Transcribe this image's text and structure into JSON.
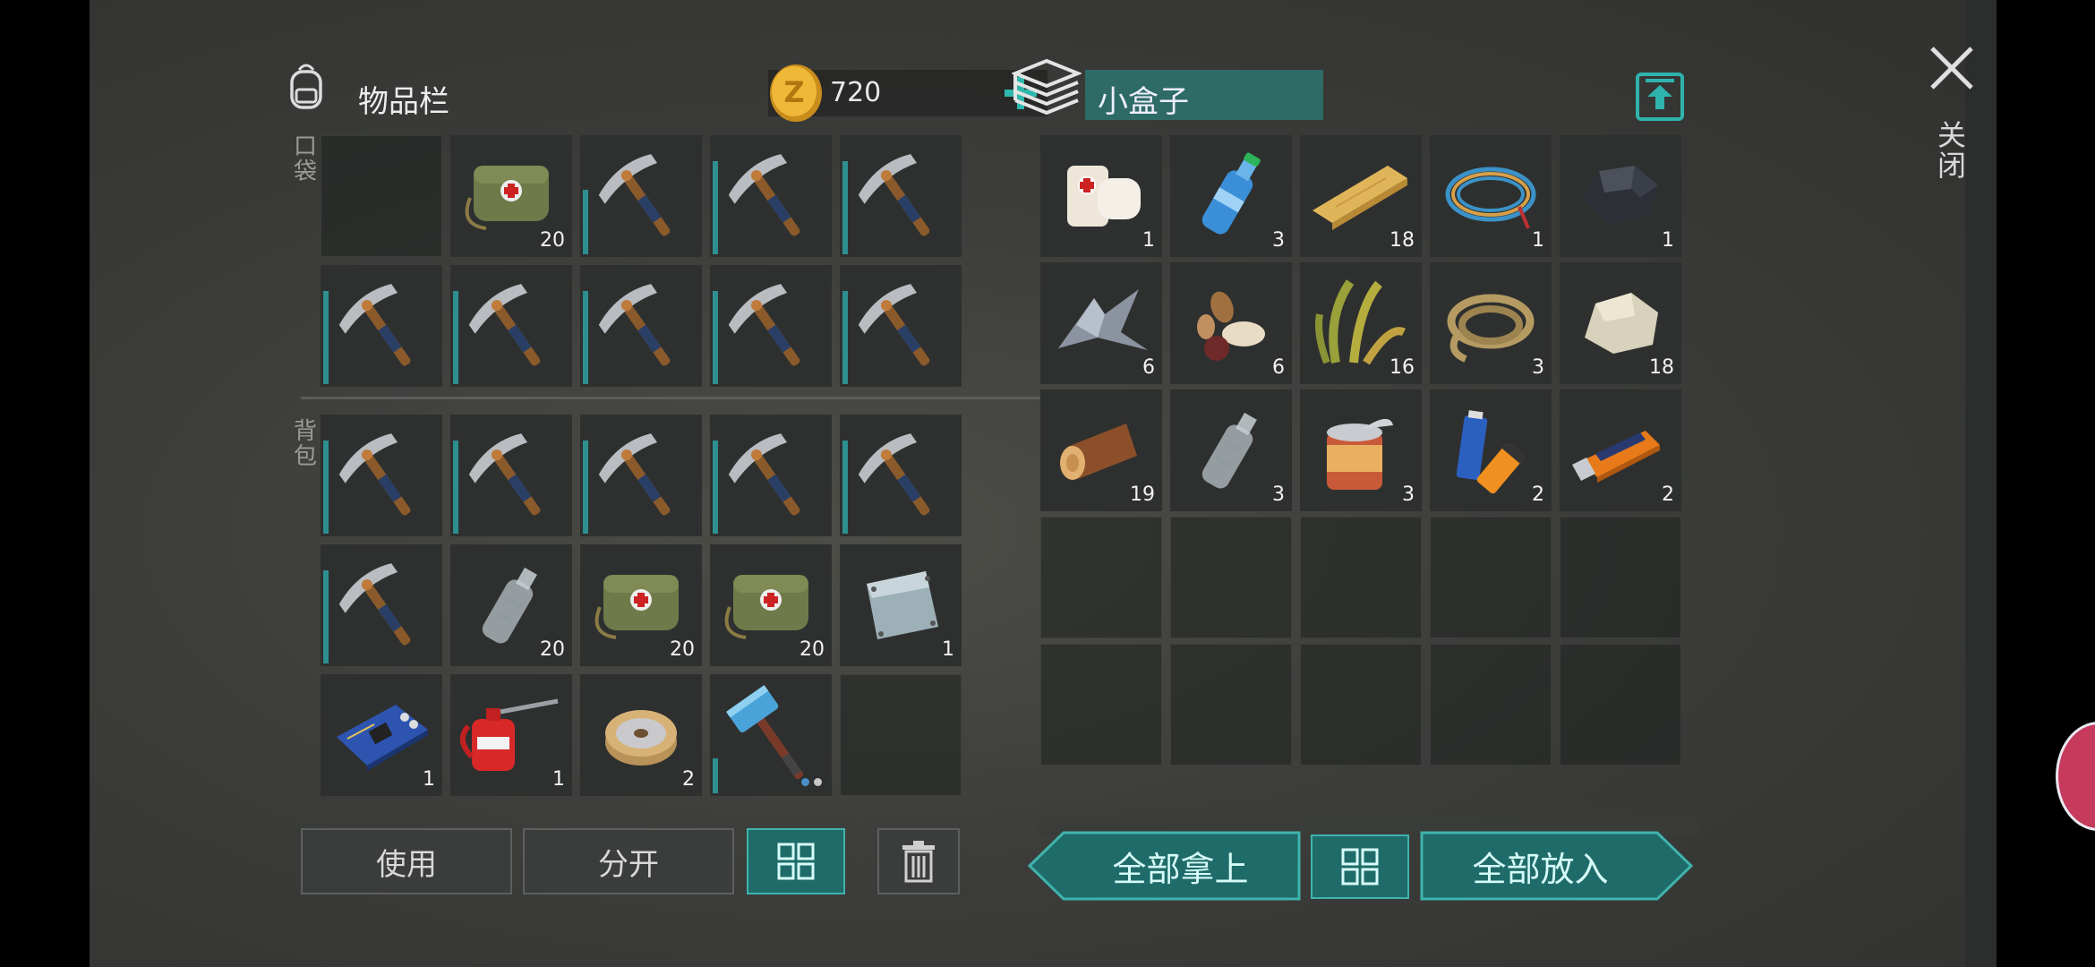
{
  "inventory": {
    "title": "物品栏",
    "currency": {
      "amount": "720",
      "symbol": "Z"
    },
    "pocket_label": "口袋",
    "backpack_label": "背包",
    "pocket_slots": [
      {
        "item": "",
        "qty": ""
      },
      {
        "item": "first-aid-bag",
        "qty": "20"
      },
      {
        "item": "pickaxe",
        "qty": "",
        "durability": 0.55
      },
      {
        "item": "pickaxe",
        "qty": "",
        "durability": 0.8
      },
      {
        "item": "pickaxe",
        "qty": "",
        "durability": 0.8
      },
      {
        "item": "pickaxe",
        "qty": "",
        "durability": 0.8
      },
      {
        "item": "pickaxe",
        "qty": "",
        "durability": 0.8
      },
      {
        "item": "pickaxe",
        "qty": "",
        "durability": 0.8
      },
      {
        "item": "pickaxe",
        "qty": "",
        "durability": 0.8
      },
      {
        "item": "pickaxe",
        "qty": "",
        "durability": 0.8
      }
    ],
    "backpack_slots": [
      {
        "item": "pickaxe",
        "qty": "",
        "durability": 0.8
      },
      {
        "item": "pickaxe",
        "qty": "",
        "durability": 0.8
      },
      {
        "item": "pickaxe",
        "qty": "",
        "durability": 0.8
      },
      {
        "item": "pickaxe",
        "qty": "",
        "durability": 0.8
      },
      {
        "item": "pickaxe",
        "qty": "",
        "durability": 0.8
      },
      {
        "item": "pickaxe",
        "qty": "",
        "durability": 0.8
      },
      {
        "item": "empty-bottle",
        "qty": "20"
      },
      {
        "item": "first-aid-bag",
        "qty": "20"
      },
      {
        "item": "first-aid-bag",
        "qty": "20"
      },
      {
        "item": "metal-plate",
        "qty": "1"
      },
      {
        "item": "circuit-board",
        "qty": "1"
      },
      {
        "item": "oil-can",
        "qty": "1"
      },
      {
        "item": "wire-spool",
        "qty": "2"
      },
      {
        "item": "sledgehammer",
        "qty": "",
        "durability": 0.3
      },
      {
        "item": "",
        "qty": ""
      }
    ],
    "buttons": {
      "use": "使用",
      "split": "分开"
    }
  },
  "container": {
    "name": "小盒子",
    "slots": [
      {
        "item": "bandage",
        "qty": "1"
      },
      {
        "item": "water-bottle",
        "qty": "3"
      },
      {
        "item": "wood-plank",
        "qty": "18"
      },
      {
        "item": "wire-coil",
        "qty": "1"
      },
      {
        "item": "coal",
        "qty": "1"
      },
      {
        "item": "scrap-metal",
        "qty": "6"
      },
      {
        "item": "seeds",
        "qty": "6"
      },
      {
        "item": "plant-fiber",
        "qty": "16"
      },
      {
        "item": "rope",
        "qty": "3"
      },
      {
        "item": "stone",
        "qty": "18"
      },
      {
        "item": "log",
        "qty": "19"
      },
      {
        "item": "empty-bottle",
        "qty": "3"
      },
      {
        "item": "tin-can",
        "qty": "3"
      },
      {
        "item": "batteries",
        "qty": "2"
      },
      {
        "item": "usb-drive",
        "qty": "2"
      },
      {
        "item": "",
        "qty": ""
      },
      {
        "item": "",
        "qty": ""
      },
      {
        "item": "",
        "qty": ""
      },
      {
        "item": "",
        "qty": ""
      },
      {
        "item": "",
        "qty": ""
      },
      {
        "item": "",
        "qty": ""
      },
      {
        "item": "",
        "qty": ""
      },
      {
        "item": "",
        "qty": ""
      },
      {
        "item": "",
        "qty": ""
      },
      {
        "item": "",
        "qty": ""
      }
    ],
    "buttons": {
      "take_all": "全部拿上",
      "put_all": "全部放入"
    }
  },
  "close_label": "关闭",
  "colors": {
    "accent": "#2d8f8f",
    "teal_button": "#1f6b69",
    "gold": "#e2a82a"
  }
}
